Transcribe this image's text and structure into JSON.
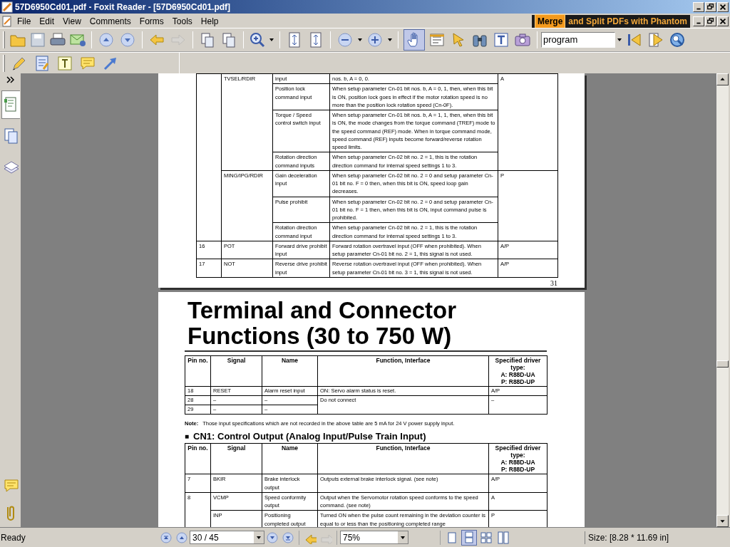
{
  "window": {
    "title": "57D6950Cd01.pdf - Foxit Reader - [57D6950Cd01.pdf]"
  },
  "menu": [
    "File",
    "Edit",
    "View",
    "Comments",
    "Forms",
    "Tools",
    "Help"
  ],
  "ad_banner": {
    "highlight": "Merge",
    "text": "and Split PDFs with Phantom"
  },
  "toolbar": {
    "forward_disabled": true,
    "hand_tool_selected": true,
    "search_value": "program"
  },
  "left_panel": {
    "tabs": [
      {
        "selected": true
      },
      {
        "selected": false
      },
      {
        "selected": false
      }
    ]
  },
  "pages": [
    {
      "table": {
        "rows": [
          {
            "signal": "TVSEL/RDIR",
            "name": "input",
            "function": "nos. b, A = 0, 0.",
            "type": "A"
          },
          {
            "name": "Position lock command input",
            "function": "When setup parameter Cn-01 bit nos. b, A = 0, 1, then, when this bit is ON, position lock goes in effect if the motor rotation speed is no more than the position lock rotation speed (Cn-0F)."
          },
          {
            "name": "Torque / Speed control switch input",
            "function": "When setup parameter Cn-01 bit nos. b, A = 1, 1, then, when this bit is ON, the mode changes from the torque command (TREF) mode to the speed command (REF) mode. When in torque command mode, speed command (REF) inputs become forward/reverse rotation speed limits."
          },
          {
            "name": "Rotation direction command inputs",
            "function": "When setup parameter Cn-02 bit no. 2 = 1, this is the rotation direction command for internal speed settings 1 to 3."
          },
          {
            "signal": "MING/IPG/RDIR",
            "name": "Gain deceleration input",
            "function": "When setup parameter Cn-02 bit no. 2 = 0 and setup parameter Cn-01 bit no. F = 0 then, when this bit is ON, speed loop gain decreases.",
            "type": "P"
          },
          {
            "name": "Pulse prohibit",
            "function": "When setup parameter Cn-02 bit no. 2 = 0 and setup parameter Cn-01 bit no. F = 1 then, when this bit is ON, input command pulse is prohibited."
          },
          {
            "name": "Rotation direction command input",
            "function": "When setup parameter Cn-02 bit no. 2 = 1, this is the rotation direction command for internal speed settings 1 to 3."
          },
          {
            "pin": "16",
            "signal": "POT",
            "name": "Forward drive prohibit input",
            "function": "Forward rotation overtravel input (OFF when prohibited). When setup parameter Cn-01 bit no. 2 = 1, this signal is not used.",
            "type": "A/P"
          },
          {
            "pin": "17",
            "signal": "NOT",
            "name": "Reverse drive prohibit input",
            "function": "Reverse rotation overtravel input (OFF when prohibited). When setup parameter Cn-01 bit no. 3 = 1, this signal is not used.",
            "type": "A/P"
          }
        ]
      },
      "page_number": "31"
    },
    {
      "heading": "Terminal and Connector Functions (30 to 750 W)",
      "table": {
        "columns": [
          "Pin no.",
          "Signal",
          "Name",
          "Function, Interface",
          [
            "Specified driver type:",
            "A: R88D-UA",
            "P: R88D-UP"
          ]
        ],
        "rows": [
          {
            "pin": "18",
            "signal": "RESET",
            "name": "Alarm reset input",
            "function": "ON: Servo alarm status is reset.",
            "type": "A/P"
          },
          {
            "pin": "28",
            "signal": "–",
            "name": "–",
            "function": "Do not connect",
            "type": "–"
          },
          {
            "pin": "29",
            "signal": "–",
            "name": "–"
          }
        ]
      },
      "note": {
        "label": "Note:",
        "text": "Those input specifications which are not recorded in the above table are 5 mA for 24 V power supply input."
      },
      "section": {
        "bullet": "■",
        "title": "CN1: Control Output (Analog Input/Pulse Train Input)"
      },
      "table2": {
        "columns": [
          "Pin no.",
          "Signal",
          "Name",
          "Function, Interface",
          [
            "Specified driver type:",
            "A: R88D-UA",
            "P: R88D-UP"
          ]
        ],
        "rows": [
          {
            "pin": "7",
            "signal": "BKIR",
            "name": "Brake interlock output",
            "function": "Outputs external brake interlock signal. (see note)",
            "type": "A/P"
          },
          {
            "pin": "8",
            "signal": "VCMP",
            "name": "Speed conformity output",
            "function": "Output when the Servomotor rotation speed conforms to the speed command. (see note)",
            "type": "A"
          },
          {
            "signal": "INP",
            "name": "Positioning completed output",
            "function": "Turned ON when the pulse count remaining in the deviation counter is equal to or less than the positioning completed range",
            "type": "P"
          }
        ]
      }
    }
  ],
  "status_bar": {
    "status": "Ready",
    "page": "30 / 45",
    "zoom": "75%",
    "view_modes": [
      {
        "selected": false
      },
      {
        "selected": true
      },
      {
        "selected": false
      },
      {
        "selected": false
      }
    ],
    "size": "Size: [8.28 * 11.69 in]"
  }
}
